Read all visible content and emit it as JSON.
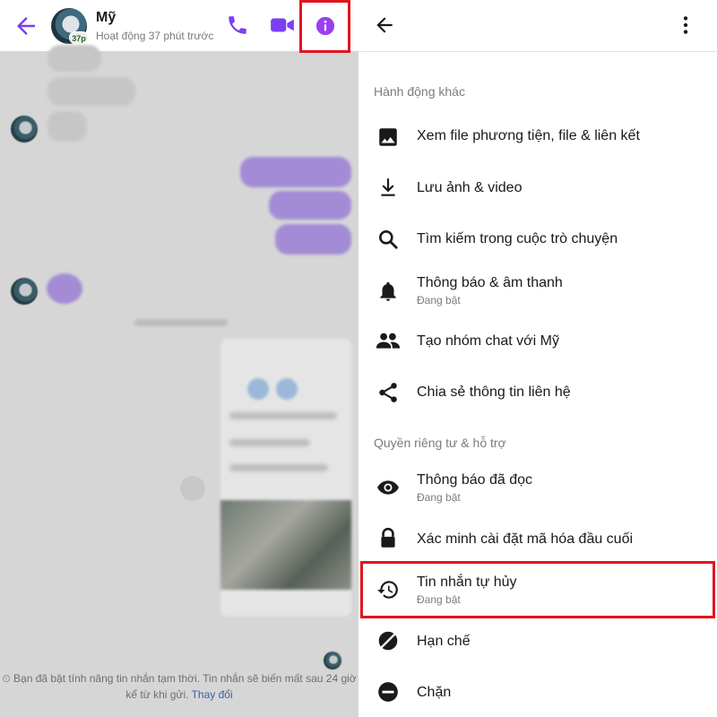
{
  "chat": {
    "contact_name": "Mỹ",
    "avatar_badge": "37p",
    "status": "Hoạt động 37 phút trước",
    "footer_note_text": "Bạn đã bật tính năng tin nhắn tạm thời. Tin nhắn sẽ biến mất sau 24 giờ kể từ khi gửi.",
    "footer_note_link": "Thay đổi",
    "accent_color": "#7b3ff2"
  },
  "settings": {
    "section_more_actions": "Hành động khác",
    "section_privacy": "Quyền riêng tư & hỗ trợ",
    "items": [
      {
        "label": "Xem file phương tiện, file & liên kết",
        "sub": ""
      },
      {
        "label": "Lưu ảnh & video",
        "sub": ""
      },
      {
        "label": "Tìm kiếm trong cuộc trò chuyện",
        "sub": ""
      },
      {
        "label": "Thông báo & âm thanh",
        "sub": "Đang bật"
      },
      {
        "label": "Tạo nhóm chat với Mỹ",
        "sub": ""
      },
      {
        "label": "Chia sẻ thông tin liên hệ",
        "sub": ""
      },
      {
        "label": "Thông báo đã đọc",
        "sub": "Đang bật"
      },
      {
        "label": "Xác minh cài đặt mã hóa đầu cuối",
        "sub": ""
      },
      {
        "label": "Tin nhắn tự hủy",
        "sub": "Đang bật"
      },
      {
        "label": "Hạn chế",
        "sub": ""
      },
      {
        "label": "Chặn",
        "sub": ""
      }
    ]
  },
  "colors": {
    "highlight": "#e0161e",
    "icon_dark": "#1a1a1a",
    "secondary_text": "#7b7b7b"
  }
}
